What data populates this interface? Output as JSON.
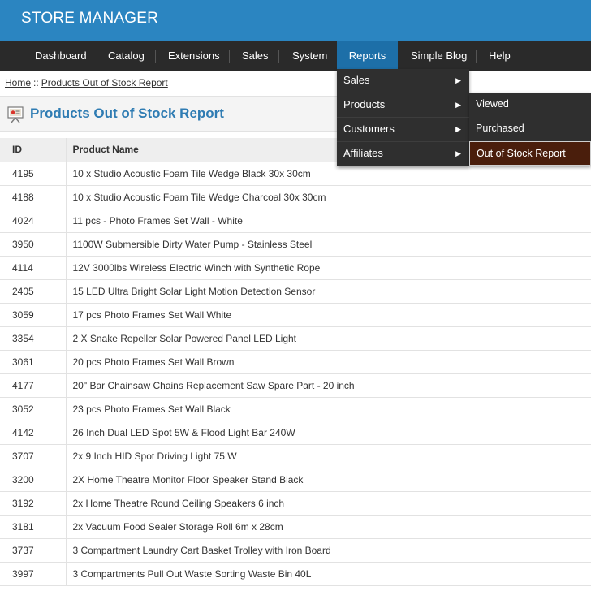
{
  "app": {
    "title": "STORE MANAGER"
  },
  "nav": {
    "items": [
      "Dashboard",
      "Catalog",
      "Extensions",
      "Sales",
      "System",
      "Reports",
      "Simple Blog",
      "Help"
    ]
  },
  "breadcrumb": {
    "home": "Home",
    "separator": "::",
    "current": "Products Out of Stock Report"
  },
  "page": {
    "title": "Products Out of Stock Report",
    "icon": "report-icon"
  },
  "reports_menu": {
    "items": [
      "Sales",
      "Products",
      "Customers",
      "Affiliates"
    ],
    "products_submenu": [
      "Viewed",
      "Purchased",
      "Out of Stock Report"
    ]
  },
  "table": {
    "headers": [
      "ID",
      "Product Name"
    ],
    "rows": [
      [
        "4195",
        "10 x Studio Acoustic Foam Tile Wedge Black 30x 30cm"
      ],
      [
        "4188",
        "10 x Studio Acoustic Foam Tile Wedge Charcoal 30x 30cm"
      ],
      [
        "4024",
        "11 pcs - Photo Frames Set Wall - White"
      ],
      [
        "3950",
        "1100W Submersible Dirty Water Pump - Stainless Steel"
      ],
      [
        "4114",
        "12V 3000lbs Wireless Electric Winch with Synthetic Rope"
      ],
      [
        "2405",
        "15 LED Ultra Bright Solar Light Motion Detection Sensor"
      ],
      [
        "3059",
        "17 pcs Photo Frames Set Wall White"
      ],
      [
        "3354",
        "2 X Snake Repeller Solar Powered Panel LED Light"
      ],
      [
        "3061",
        "20 pcs Photo Frames Set Wall Brown"
      ],
      [
        "4177",
        "20\" Bar Chainsaw Chains Replacement Saw Spare Part - 20 inch"
      ],
      [
        "3052",
        "23 pcs Photo Frames Set Wall Black"
      ],
      [
        "4142",
        "26 Inch Dual LED Spot 5W & Flood Light Bar 240W"
      ],
      [
        "3707",
        "2x 9 Inch HID Spot Driving Light 75 W"
      ],
      [
        "3200",
        "2X Home Theatre Monitor Floor Speaker Stand Black"
      ],
      [
        "3192",
        "2x Home Theatre Round Ceiling Speakers 6 inch"
      ],
      [
        "3181",
        "2x Vacuum Food Sealer Storage Roll 6m x 28cm"
      ],
      [
        "3737",
        "3 Compartment Laundry Cart Basket Trolley with Iron Board"
      ],
      [
        "3997",
        "3 Compartments Pull Out Waste Sorting Waste Bin 40L"
      ]
    ]
  },
  "colors": {
    "header": "#2b85c1",
    "nav": "#2a2a2a",
    "nav_active": "#1d6fa8",
    "title": "#2f7cb3",
    "menu": "#2f2f2f",
    "menu_selected": "#4a1e0c"
  }
}
